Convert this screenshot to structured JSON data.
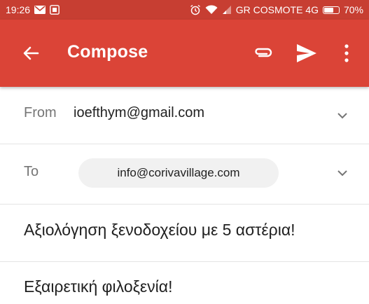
{
  "status_bar": {
    "time": "19:26",
    "left_icons": [
      "mail-icon",
      "screenshot-icon"
    ],
    "right_icons": [
      "alarm-icon",
      "wifi-icon",
      "signal-icon"
    ],
    "carrier": "GR COSMOTE 4G",
    "battery_level": 0.7,
    "battery_text": "70%"
  },
  "app_bar": {
    "title": "Compose",
    "background": "#db4437",
    "status_background": "#c73e32",
    "icons": [
      "back-arrow-icon",
      "attach-icon",
      "send-icon",
      "more-vert-icon"
    ]
  },
  "from_row": {
    "label": "From",
    "value": "ioefthym@gmail.com"
  },
  "to_row": {
    "label": "To",
    "recipients": [
      "info@corivavillage.com"
    ]
  },
  "subject": "Αξιολόγηση ξενοδοχείου με 5 αστέρια!",
  "body": "Εξαιρετική φιλοξενία!"
}
